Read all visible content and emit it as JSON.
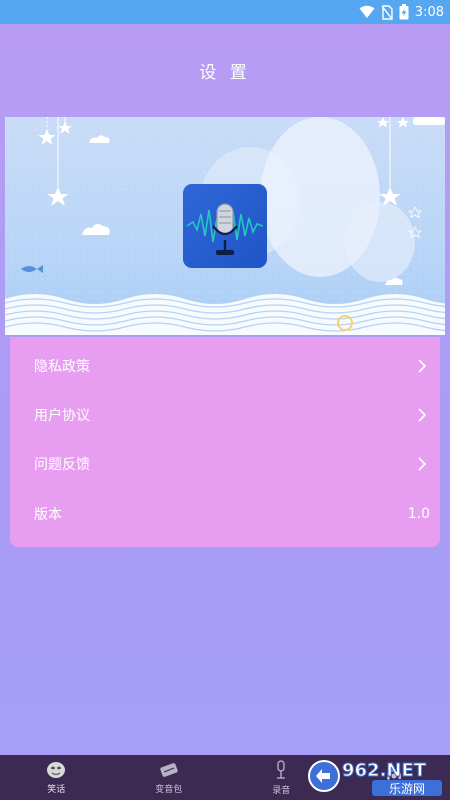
{
  "status_bar": {
    "time": "3:08",
    "bg_color": "#56a7f1"
  },
  "header": {
    "title": "设 置"
  },
  "menu": {
    "items": [
      {
        "label": "隐私政策",
        "chevron": "chevron-right-icon"
      },
      {
        "label": "用户协议",
        "chevron": "chevron-right-icon"
      },
      {
        "label": "问题反馈",
        "chevron": "chevron-right-icon"
      },
      {
        "label": "版本",
        "value": "1.0"
      }
    ],
    "card_color": "#e89ef0"
  },
  "tabs": [
    {
      "label": "笑话",
      "icon": "face-icon",
      "active": true
    },
    {
      "label": "变音包",
      "icon": "package-icon",
      "active": false
    },
    {
      "label": "录音",
      "icon": "microphone-icon",
      "active": false
    },
    {
      "label": "",
      "icon": "settings-icon",
      "active": false
    }
  ],
  "watermark": {
    "text": "962.NET",
    "subtext": "乐游网"
  },
  "colors": {
    "accent": "#b99cf3",
    "tab_bar": "#3d2a52"
  }
}
